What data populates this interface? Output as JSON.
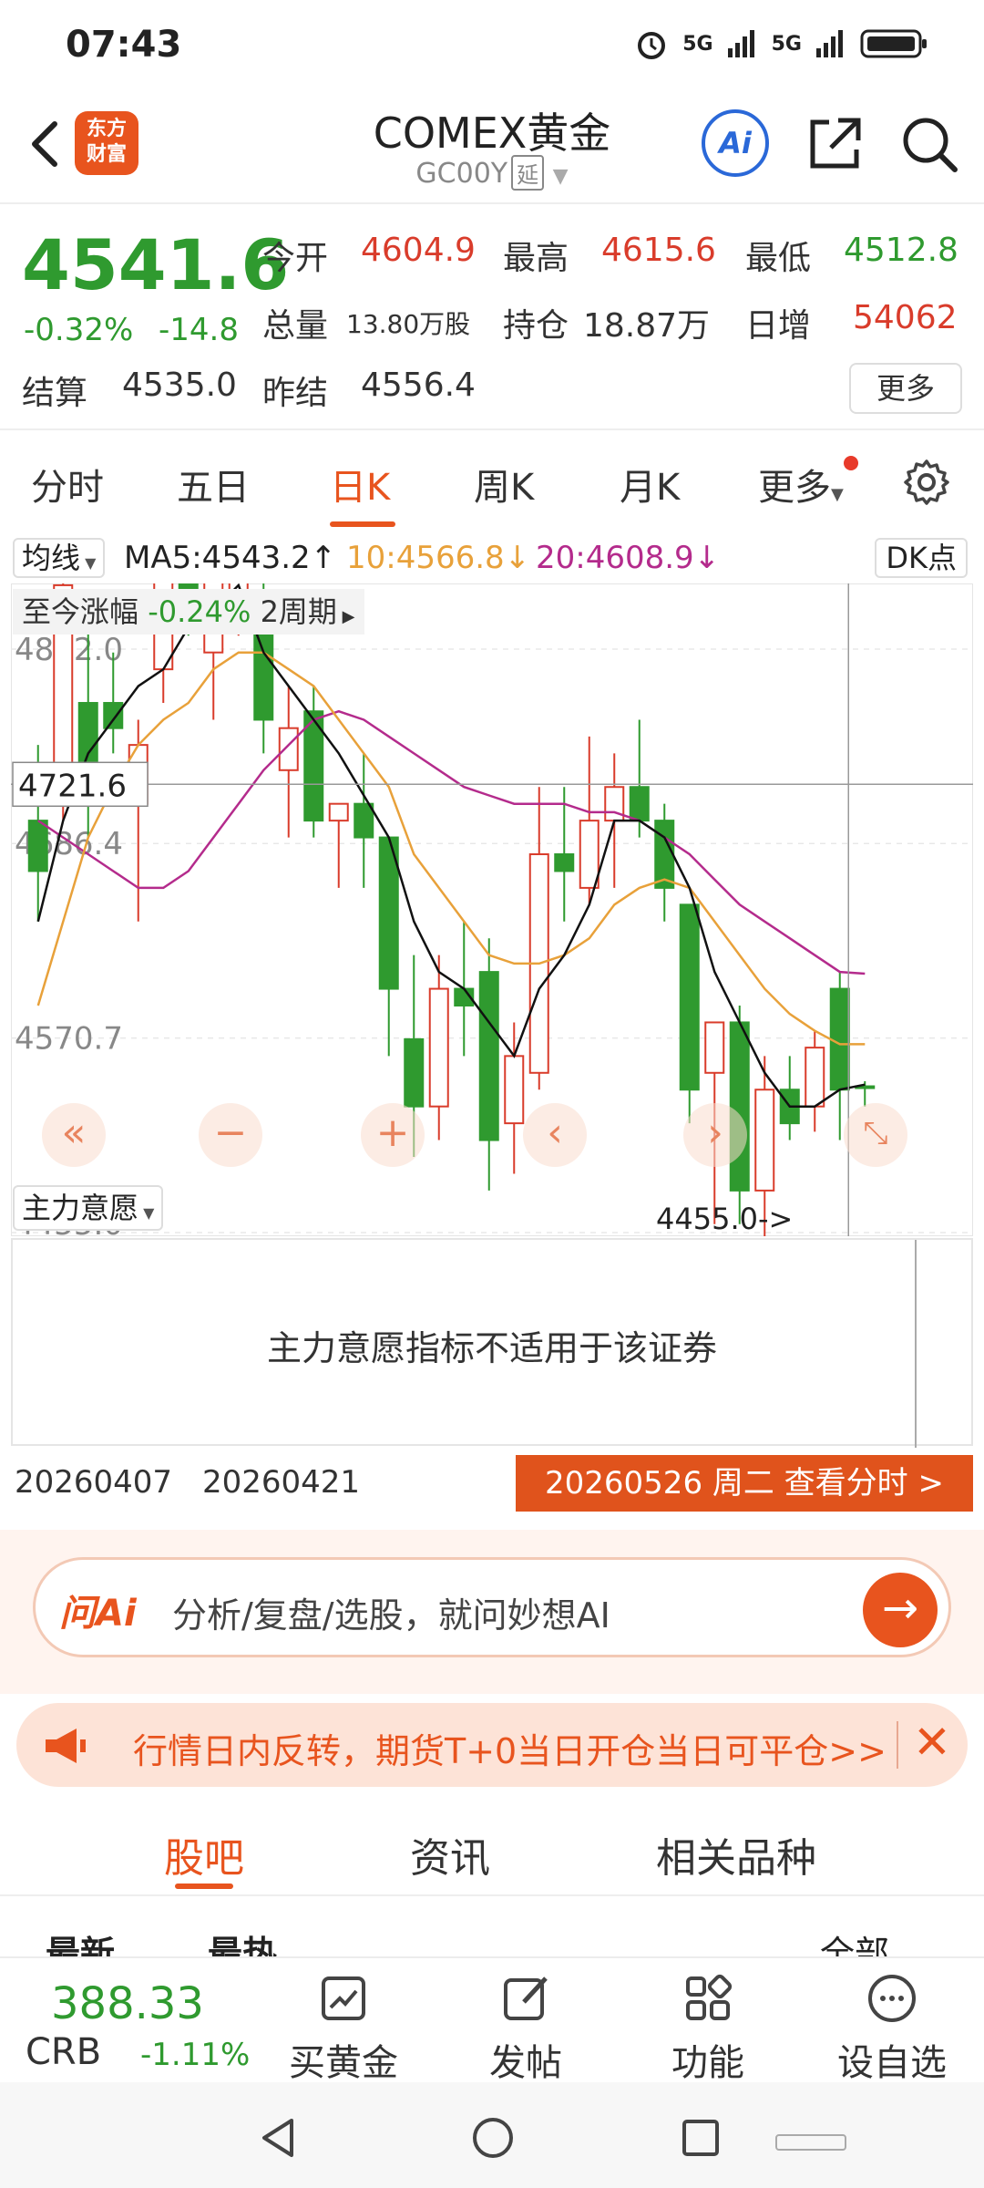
{
  "status": {
    "time": "07:43",
    "net1": "5G",
    "net2": "5G"
  },
  "header": {
    "logo": "东方\n财富",
    "title": "COMEX黄金",
    "code": "GC00Y",
    "delay_badge": "延",
    "ai_label": "Ai"
  },
  "quote": {
    "price": "4541.6",
    "change_pct": "-0.32%",
    "change": "-14.8",
    "open_label": "今开",
    "open": "4604.9",
    "high_label": "最高",
    "high": "4615.6",
    "low_label": "最低",
    "low": "4512.8",
    "volume_label": "总量",
    "volume": "13.80万股",
    "oi_label": "持仓",
    "oi": "18.87万",
    "daily_inc_label": "日增",
    "daily_inc": "54062",
    "settle_label": "结算",
    "settle": "4535.0",
    "prev_settle_label": "昨结",
    "prev_settle": "4556.4",
    "more": "更多"
  },
  "ktabs": [
    "分时",
    "五日",
    "日K",
    "周K",
    "月K",
    "更多"
  ],
  "ktabs_active": "日K",
  "chart": {
    "ma_select": "均线",
    "ma5": "MA5:4543.2↑",
    "ma10": "10:4566.8↓",
    "ma20": "20:4608.9↓",
    "dk": "DK点",
    "since_label": "至今涨幅",
    "since_value": "-0.24%",
    "since_period": "2周期",
    "y_labels": [
      "4802.0",
      "4686.4",
      "4570.7",
      "4455.0"
    ],
    "crosshair_value": "4721.6",
    "low_marker": "4455.0->",
    "ma_colors": {
      "ma5": "#111111",
      "ma10": "#e8a13a",
      "ma20": "#b42b8c"
    },
    "up_color": "#d93c2b",
    "down_color": "#2f9a2f",
    "indicator_select": "主力意愿",
    "indicator_msg": "主力意愿指标不适用于该证券",
    "date_start": "20260407",
    "date_mid": "20260421",
    "date_bar": "20260526 周二 查看分时 >"
  },
  "chart_data": {
    "type": "candlestick",
    "ylim": [
      4455.0,
      4802.0
    ],
    "candles": [
      {
        "o": 4700,
        "h": 4745,
        "l": 4640,
        "c": 4670
      },
      {
        "o": 4720,
        "h": 4870,
        "l": 4700,
        "c": 4840
      },
      {
        "o": 4770,
        "h": 4815,
        "l": 4690,
        "c": 4725
      },
      {
        "o": 4770,
        "h": 4800,
        "l": 4740,
        "c": 4755
      },
      {
        "o": 4710,
        "h": 4760,
        "l": 4640,
        "c": 4745
      },
      {
        "o": 4790,
        "h": 4900,
        "l": 4770,
        "c": 4880
      },
      {
        "o": 4880,
        "h": 4895,
        "l": 4810,
        "c": 4830
      },
      {
        "o": 4800,
        "h": 4880,
        "l": 4760,
        "c": 4860
      },
      {
        "o": 4830,
        "h": 4870,
        "l": 4810,
        "c": 4845
      },
      {
        "o": 4835,
        "h": 4845,
        "l": 4740,
        "c": 4760
      },
      {
        "o": 4730,
        "h": 4780,
        "l": 4690,
        "c": 4755
      },
      {
        "o": 4765,
        "h": 4780,
        "l": 4690,
        "c": 4700
      },
      {
        "o": 4700,
        "h": 4710,
        "l": 4660,
        "c": 4710
      },
      {
        "o": 4710,
        "h": 4740,
        "l": 4660,
        "c": 4690
      },
      {
        "o": 4690,
        "h": 4690,
        "l": 4560,
        "c": 4600
      },
      {
        "o": 4570,
        "h": 4620,
        "l": 4500,
        "c": 4530
      },
      {
        "o": 4530,
        "h": 4620,
        "l": 4510,
        "c": 4600
      },
      {
        "o": 4600,
        "h": 4640,
        "l": 4560,
        "c": 4590
      },
      {
        "o": 4610,
        "h": 4630,
        "l": 4480,
        "c": 4510
      },
      {
        "o": 4520,
        "h": 4580,
        "l": 4490,
        "c": 4560
      },
      {
        "o": 4550,
        "h": 4720,
        "l": 4540,
        "c": 4680
      },
      {
        "o": 4680,
        "h": 4720,
        "l": 4640,
        "c": 4670
      },
      {
        "o": 4660,
        "h": 4750,
        "l": 4650,
        "c": 4700
      },
      {
        "o": 4700,
        "h": 4740,
        "l": 4660,
        "c": 4720
      },
      {
        "o": 4720,
        "h": 4760,
        "l": 4690,
        "c": 4700
      },
      {
        "o": 4700,
        "h": 4710,
        "l": 4640,
        "c": 4660
      },
      {
        "o": 4650,
        "h": 4650,
        "l": 4520,
        "c": 4540
      },
      {
        "o": 4550,
        "h": 4560,
        "l": 4460,
        "c": 4580
      },
      {
        "o": 4580,
        "h": 4590,
        "l": 4460,
        "c": 4480
      },
      {
        "o": 4480,
        "h": 4560,
        "l": 4450,
        "c": 4540
      },
      {
        "o": 4540,
        "h": 4560,
        "l": 4510,
        "c": 4520
      },
      {
        "o": 4530,
        "h": 4575,
        "l": 4515,
        "c": 4565
      },
      {
        "o": 4600,
        "h": 4610,
        "l": 4510,
        "c": 4540
      },
      {
        "o": 4542,
        "h": 4545,
        "l": 4530,
        "c": 4541
      }
    ],
    "ma5": [
      4640,
      4700,
      4740,
      4760,
      4780,
      4790,
      4815,
      4825,
      4840,
      4800,
      4780,
      4760,
      4740,
      4715,
      4690,
      4640,
      4610,
      4600,
      4580,
      4560,
      4600,
      4620,
      4650,
      4700,
      4700,
      4690,
      4660,
      4610,
      4580,
      4550,
      4530,
      4530,
      4540,
      4543
    ],
    "ma10": [
      4590,
      4640,
      4690,
      4720,
      4745,
      4760,
      4770,
      4790,
      4800,
      4800,
      4790,
      4780,
      4760,
      4740,
      4720,
      4680,
      4660,
      4640,
      4620,
      4615,
      4615,
      4620,
      4630,
      4650,
      4660,
      4665,
      4660,
      4640,
      4620,
      4600,
      4585,
      4575,
      4567,
      4567
    ],
    "ma20": [
      4700,
      4690,
      4680,
      4670,
      4660,
      4660,
      4670,
      4690,
      4710,
      4730,
      4745,
      4760,
      4765,
      4760,
      4750,
      4740,
      4730,
      4720,
      4715,
      4710,
      4710,
      4710,
      4705,
      4705,
      4700,
      4690,
      4680,
      4665,
      4650,
      4640,
      4630,
      4620,
      4610,
      4609
    ]
  },
  "ai_bar": {
    "logo": "问Ai",
    "placeholder": "分析/复盘/选股，就问妙想AI"
  },
  "notice": {
    "text": "行情日内反转，期货T+0当日开仓当日可平仓>>"
  },
  "content_tabs": [
    "股吧",
    "资讯",
    "相关品种"
  ],
  "content_tabs_active": "股吧",
  "sort": {
    "latest": "最新",
    "hot": "最热",
    "filter": "全部"
  },
  "bottom_nav": {
    "crb_value": "388.33",
    "crb_name": "CRB",
    "crb_change": "-1.11%",
    "items": [
      "买黄金",
      "发帖",
      "功能",
      "设自选"
    ]
  }
}
